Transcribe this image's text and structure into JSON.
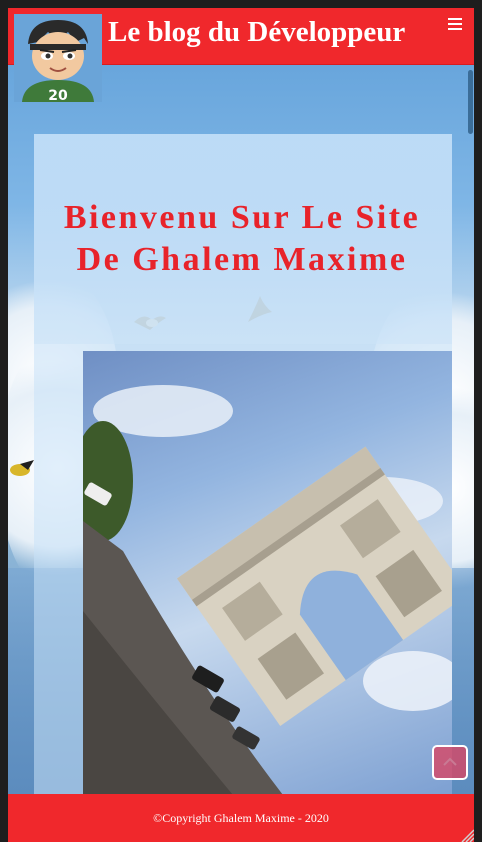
{
  "header": {
    "site_title": "Le blog du Développeur",
    "avatar_icon": "developer-avatar-icon",
    "menu_icon": "hamburger-menu-icon"
  },
  "main": {
    "welcome_text": "Bienvenu Sur Le Site De Ghalem Maxime",
    "photo_subject": "arc-de-triomphe-photo"
  },
  "footer": {
    "copyright": "©Copyright Ghalem Maxime - 2020"
  },
  "controls": {
    "back_to_top_icon": "arrow-up-icon"
  },
  "colors": {
    "brand_red": "#f0282c",
    "title_red": "#e8232a"
  }
}
